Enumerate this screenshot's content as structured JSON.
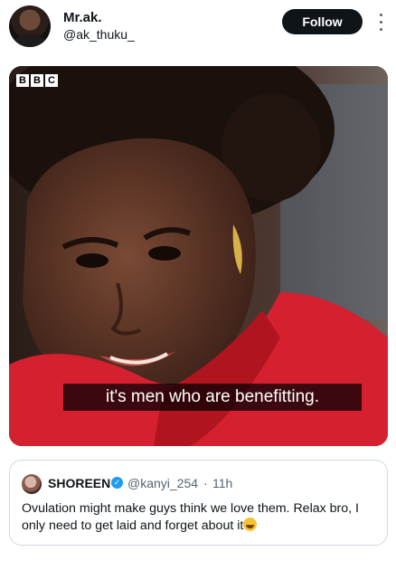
{
  "tweet": {
    "display_name": "Mr.ak.",
    "handle": "@ak_thuku_",
    "follow_label": "Follow",
    "more_icon": "more-vertical-icon"
  },
  "media": {
    "logo_letters": [
      "B",
      "B",
      "C"
    ],
    "subtitle": "it's men who are benefitting."
  },
  "quoted": {
    "name": "SHOREEN",
    "verified_icon": "verified-badge-icon",
    "handle": "@kanyi_254",
    "separator": "·",
    "time": "11h",
    "text": "Ovulation might make guys think we love them. Relax bro, I only need to get laid and forget about it",
    "emoji": "grinning-sweat-emoji"
  },
  "colors": {
    "follow_bg": "#0f1419",
    "verified": "#1d9bf0",
    "muted_text": "#536471",
    "border": "#cfd9de"
  }
}
